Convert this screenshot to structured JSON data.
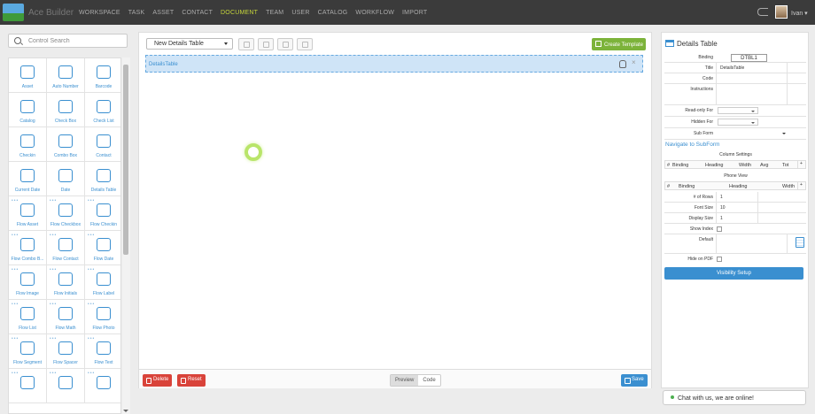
{
  "app": {
    "logo_text": "Ace Builder",
    "nav": [
      "WORKSPACE",
      "TASK",
      "ASSET",
      "CONTACT",
      "DOCUMENT",
      "TEAM",
      "USER",
      "CATALOG",
      "WORKFLOW",
      "IMPORT"
    ],
    "active_nav": "DOCUMENT",
    "user_name": "Ivan"
  },
  "left": {
    "search_placeholder": "Control Search",
    "controls": [
      {
        "label": "Asset",
        "icon": "location-pin-icon",
        "flow": false
      },
      {
        "label": "Auto Number",
        "icon": "auto-number-icon",
        "flow": false
      },
      {
        "label": "Barcode",
        "icon": "barcode-icon",
        "flow": false
      },
      {
        "label": "Catalog",
        "icon": "catalog-icon",
        "flow": false
      },
      {
        "label": "Check Box",
        "icon": "checkmark-icon",
        "flow": false
      },
      {
        "label": "Check List",
        "icon": "checklist-icon",
        "flow": false
      },
      {
        "label": "Checkin",
        "icon": "clock-icon",
        "flow": false
      },
      {
        "label": "Combo Box",
        "icon": "combo-box-icon",
        "flow": false
      },
      {
        "label": "Contact",
        "icon": "contact-icon",
        "flow": false
      },
      {
        "label": "Current Date",
        "icon": "calendar-31-icon",
        "flow": false
      },
      {
        "label": "Date",
        "icon": "calendar-icon",
        "flow": false
      },
      {
        "label": "Details Table",
        "icon": "details-table-icon",
        "flow": false
      },
      {
        "label": "Flow Asset",
        "icon": "location-pin-icon",
        "flow": true
      },
      {
        "label": "Flow Checkbox",
        "icon": "checkmark-icon",
        "flow": true
      },
      {
        "label": "Flow Checkin",
        "icon": "clock-icon",
        "flow": true
      },
      {
        "label": "Flow Combo B...",
        "icon": "combo-box-icon",
        "flow": true
      },
      {
        "label": "Flow Contact",
        "icon": "contact-icon",
        "flow": true
      },
      {
        "label": "Flow Date",
        "icon": "calendar-icon",
        "flow": true
      },
      {
        "label": "Flow Image",
        "icon": "image-icon",
        "flow": true
      },
      {
        "label": "Flow Initials",
        "icon": "signature-icon",
        "flow": true
      },
      {
        "label": "Flow Label",
        "icon": "label-abc-icon",
        "flow": true
      },
      {
        "label": "Flow List",
        "icon": "list-icon",
        "flow": true
      },
      {
        "label": "Flow Math",
        "icon": "calculator-icon",
        "flow": true
      },
      {
        "label": "Flow Photo",
        "icon": "camera-icon",
        "flow": true
      },
      {
        "label": "Flow Segment",
        "icon": "segment-icon",
        "flow": true
      },
      {
        "label": "Flow Spacer",
        "icon": "spacer-icon",
        "flow": true
      },
      {
        "label": "Flow Text",
        "icon": "text-input-icon",
        "flow": true
      },
      {
        "label": "",
        "icon": "list-icon",
        "flow": true
      },
      {
        "label": "",
        "icon": "map-pin-icon",
        "flow": true
      },
      {
        "label": "",
        "icon": "chart-icon",
        "flow": true
      }
    ]
  },
  "center": {
    "form_select": "New Details Table",
    "create_template_label": "Create Template",
    "dropzone_label": "DetailsTable",
    "close_glyph": "×",
    "delete_label": "Delete",
    "reset_label": "Reset",
    "preview_label": "Preview",
    "code_label": "Code",
    "save_label": "Save"
  },
  "right": {
    "title": "Details Table",
    "binding_label": "Binding",
    "binding_value": "DTBL1",
    "title_label": "Title",
    "title_value": "DetailsTable",
    "code_label": "Code",
    "instructions_label": "Instructions",
    "readonly_label": "Read-only For",
    "hidden_label": "Hidden For",
    "subform_label": "Sub Form",
    "navigate_link": "Navigate to SubForm",
    "column_settings_label": "Column Settings",
    "col_headers": [
      "#",
      "Binding",
      "Heading",
      "Width",
      "Avg",
      "Tot",
      "+"
    ],
    "phone_view_label": "Phone View",
    "phone_headers": [
      "#",
      "Binding",
      "Heading",
      "Width",
      "+"
    ],
    "rows_label": "# of Rows",
    "rows_value": "1",
    "font_size_label": "Font Size",
    "font_size_value": "10",
    "display_size_label": "Display Size",
    "display_size_value": "1",
    "show_index_label": "Show Index",
    "default_label": "Default",
    "hide_pdf_label": "Hide on PDF",
    "visibility_label": "Visibility Setup"
  },
  "chat": {
    "text": "Chat with us, we are online!"
  },
  "colors": {
    "accent": "#3a8fd0",
    "active_nav": "#c5d43a",
    "create_green": "#7cb33a",
    "delete_red": "#d9433a"
  }
}
